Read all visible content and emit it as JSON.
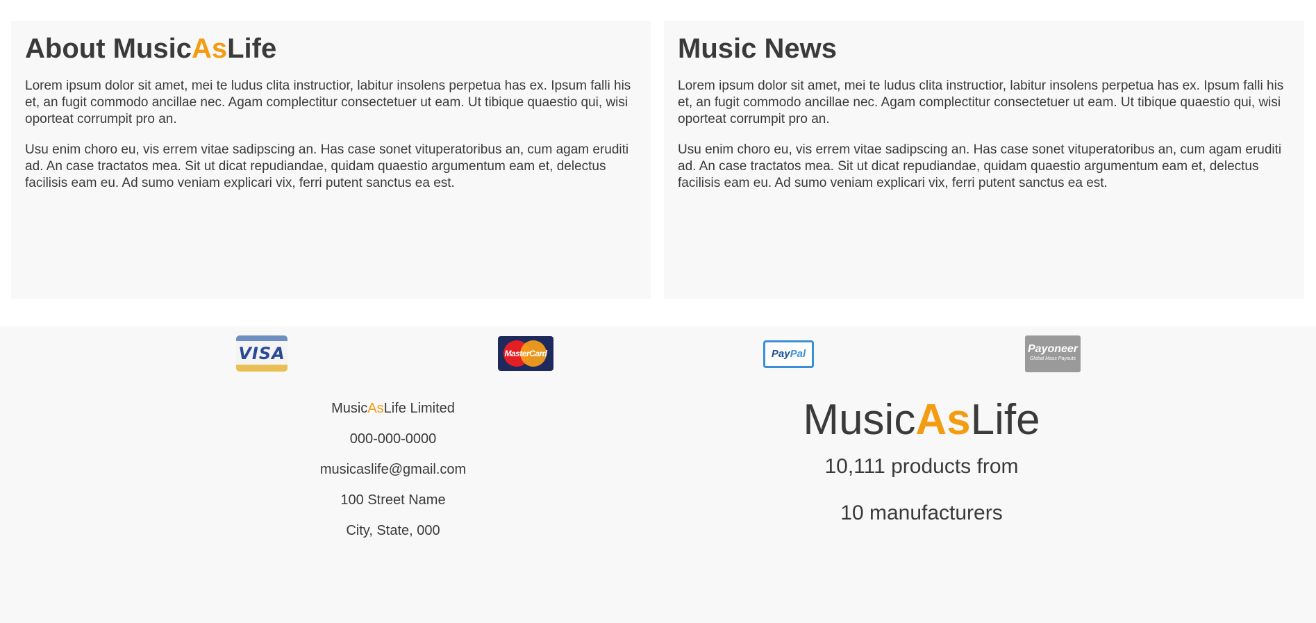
{
  "about": {
    "title_prefix": "About Music",
    "title_accent": "As",
    "title_suffix": "Life",
    "paragraphs": [
      "Lorem ipsum dolor sit amet, mei te ludus clita instructior, labitur insolens perpetua has ex. Ipsum falli his et, an fugit commodo ancillae nec. Agam complectitur consectetuer ut eam. Ut tibique quaestio qui, wisi oporteat corrumpit pro an.",
      "Usu enim choro eu, vis errem vitae sadipscing an. Has case sonet vituperatoribus an, cum agam eruditi ad. An case tractatos mea. Sit ut dicat repudiandae, quidam quaestio argumentum eam et, delectus facilisis eam eu. Ad sumo veniam explicari vix, ferri putent sanctus ea est."
    ]
  },
  "news": {
    "title": "Music News",
    "paragraphs": [
      "Lorem ipsum dolor sit amet, mei te ludus clita instructior, labitur insolens perpetua has ex. Ipsum falli his et, an fugit commodo ancillae nec. Agam complectitur consectetuer ut eam. Ut tibique quaestio qui, wisi oporteat corrumpit pro an.",
      "Usu enim choro eu, vis errem vitae sadipscing an. Has case sonet vituperatoribus an, cum agam eruditi ad. An case tractatos mea. Sit ut dicat repudiandae, quidam quaestio argumentum eam et, delectus facilisis eam eu. Ad sumo veniam explicari vix, ferri putent sanctus ea est."
    ]
  },
  "payments": {
    "visa": "VISA",
    "mastercard": "MasterCard",
    "paypal_a": "Pay",
    "paypal_b": "Pal",
    "payoneer": "Payoneer",
    "payoneer_sub": "Global Mass Payouts",
    "icons": [
      "visa-icon",
      "mastercard-icon",
      "paypal-icon",
      "payoneer-icon"
    ]
  },
  "contact": {
    "company_prefix": "Music",
    "company_accent": "As",
    "company_suffix": "Life Limited",
    "phone": "000-000-0000",
    "email": "musicaslife@gmail.com",
    "street": "100 Street Name",
    "city": "City, State, 000"
  },
  "brand": {
    "prefix": "Music",
    "accent": "As",
    "suffix": "Life",
    "products_line": "10,111 products from",
    "manufacturers_line": "10 manufacturers"
  },
  "colors": {
    "accent": "#f39c12",
    "text": "#3a3a3a",
    "panel_bg": "#f8f8f8"
  }
}
